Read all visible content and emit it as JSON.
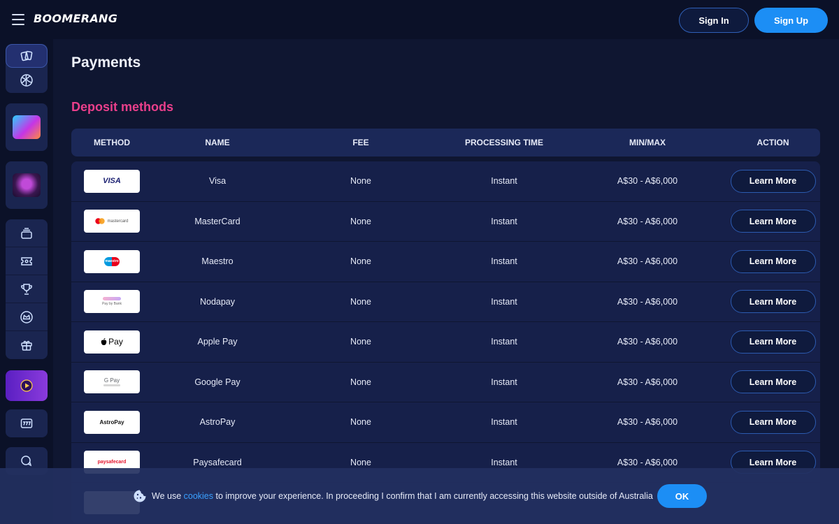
{
  "header": {
    "brand": "BOOMERANG",
    "signin_label": "Sign In",
    "signup_label": "Sign Up"
  },
  "sidebar": {
    "icons": [
      "cards-icon",
      "volleyball-icon",
      "game-tile-icon",
      "game-tile-icon",
      "layers-icon",
      "ticket-icon",
      "trophy-icon",
      "crown-icon",
      "gift-icon",
      "play-icon",
      "slot-777-icon",
      "chat-icon"
    ]
  },
  "page": {
    "title": "Payments",
    "section_title": "Deposit methods"
  },
  "table": {
    "headers": {
      "method": "METHOD",
      "name": "NAME",
      "fee": "FEE",
      "processing_time": "PROCESSING TIME",
      "minmax": "MIN/MAX",
      "action": "ACTION"
    },
    "rows": [
      {
        "logo": "VISA",
        "name": "Visa",
        "fee": "None",
        "time": "Instant",
        "minmax": "A$30 - A$6,000",
        "action": "Learn More"
      },
      {
        "logo": "mastercard",
        "name": "MasterCard",
        "fee": "None",
        "time": "Instant",
        "minmax": "A$30 - A$6,000",
        "action": "Learn More"
      },
      {
        "logo": "maestro",
        "name": "Maestro",
        "fee": "None",
        "time": "Instant",
        "minmax": "A$30 - A$6,000",
        "action": "Learn More"
      },
      {
        "logo": "Pay by Bank",
        "name": "Nodapay",
        "fee": "None",
        "time": "Instant",
        "minmax": "A$30 - A$6,000",
        "action": "Learn More"
      },
      {
        "logo": "Pay",
        "name": "Apple Pay",
        "fee": "None",
        "time": "Instant",
        "minmax": "A$30 - A$6,000",
        "action": "Learn More"
      },
      {
        "logo": "G Pay",
        "name": "Google Pay",
        "fee": "None",
        "time": "Instant",
        "minmax": "A$30 - A$6,000",
        "action": "Learn More"
      },
      {
        "logo": "AstroPay",
        "name": "AstroPay",
        "fee": "None",
        "time": "Instant",
        "minmax": "A$30 - A$6,000",
        "action": "Learn More"
      },
      {
        "logo": "paysafecard",
        "name": "Paysafecard",
        "fee": "None",
        "time": "Instant",
        "minmax": "A$30 - A$6,000",
        "action": "Learn More"
      }
    ]
  },
  "cookie": {
    "text_before": "We use ",
    "link": "cookies",
    "text_after": " to improve your experience. In proceeding I confirm that I am currently accessing this website outside of Australia",
    "ok_label": "OK"
  },
  "colors": {
    "background": "#0f1631",
    "accent_pink": "#ea3f8b",
    "accent_blue": "#1c8ef5"
  }
}
